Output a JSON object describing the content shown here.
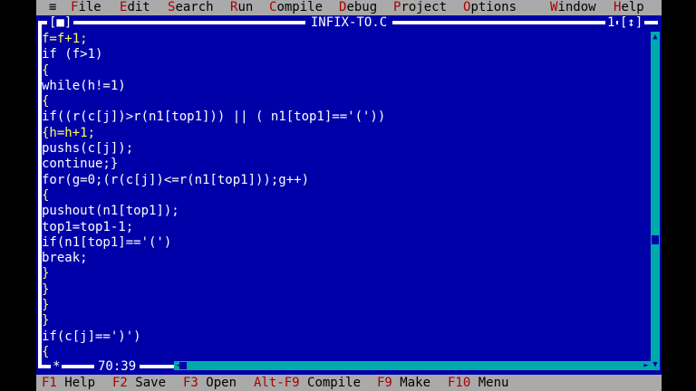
{
  "menu": {
    "system": "≡",
    "items": [
      {
        "hot": "F",
        "rest": "ile"
      },
      {
        "hot": "E",
        "rest": "dit"
      },
      {
        "hot": "S",
        "rest": "earch"
      },
      {
        "hot": "R",
        "rest": "un"
      },
      {
        "hot": "C",
        "rest": "ompile"
      },
      {
        "hot": "D",
        "rest": "ebug"
      },
      {
        "hot": "P",
        "rest": "roject"
      },
      {
        "hot": "O",
        "rest": "ptions"
      },
      {
        "hot": "W",
        "rest": "indow"
      },
      {
        "hot": "H",
        "rest": "elp"
      }
    ]
  },
  "window": {
    "title": "INFIX-TO.C",
    "close_box": "[■]",
    "zoom_box": "[↕]",
    "window_number": "1",
    "modified_marker": "*",
    "cursor_position": "70:39"
  },
  "code_lines": [
    "f=f+1;",
    "if (f>1)",
    "{",
    "while(h!=1)",
    "{",
    "if((r(c[j])>r(n1[top1])) || ( n1[top1]=='('))",
    "{h=h+1;",
    "pushs(c[j]);",
    "continue;}",
    "for(g=0;(r(c[j])<=r(n1[top1]));g++)",
    "{",
    "pushout(n1[top1]);",
    "top1=top1-1;",
    "if(n1[top1]=='(')",
    "break;",
    "}",
    "}",
    "}",
    "}",
    "if(c[j]==')')",
    "{"
  ],
  "status_bar": [
    {
      "key": "F1",
      "label": "Help"
    },
    {
      "key": "F2",
      "label": "Save"
    },
    {
      "key": "F3",
      "label": "Open"
    },
    {
      "key": "Alt-F9",
      "label": "Compile"
    },
    {
      "key": "F9",
      "label": "Make"
    },
    {
      "key": "F10",
      "label": "Menu"
    }
  ],
  "colors": {
    "background": "#0000a8",
    "menu_bg": "#aaaaaa",
    "hotkey": "#aa0000",
    "scrollbar": "#00aaaa",
    "cursor": "#aa5500"
  },
  "icons": {
    "close": "close-box-icon",
    "zoom": "zoom-box-icon",
    "scroll_up": "arrow-up-icon",
    "scroll_down": "arrow-down-icon",
    "scroll_left": "arrow-left-icon",
    "scroll_right": "arrow-right-icon"
  }
}
